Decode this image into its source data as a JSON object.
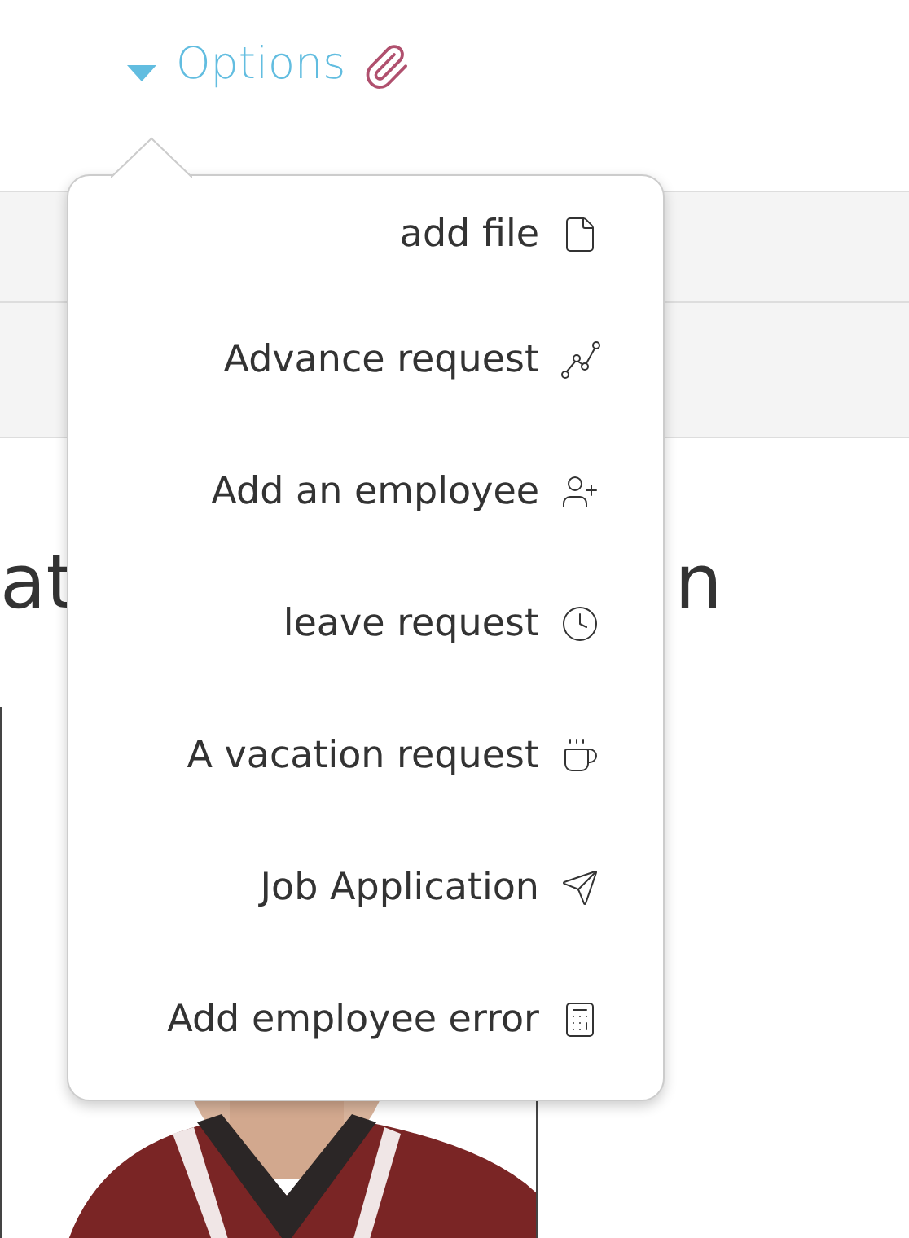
{
  "options_link": {
    "label": "Options"
  },
  "heading_fragments": [
    "at",
    "n"
  ],
  "menu": {
    "items": [
      {
        "label": "add file",
        "kind": "file"
      },
      {
        "label": "Advance request",
        "kind": "chart"
      },
      {
        "label": "Add an employee",
        "kind": "user-plus"
      },
      {
        "label": "leave request",
        "kind": "clock"
      },
      {
        "label": "A vacation request",
        "kind": "cup"
      },
      {
        "label": "Job Application",
        "kind": "send"
      },
      {
        "label": "Add employee error",
        "kind": "calculator"
      }
    ]
  }
}
